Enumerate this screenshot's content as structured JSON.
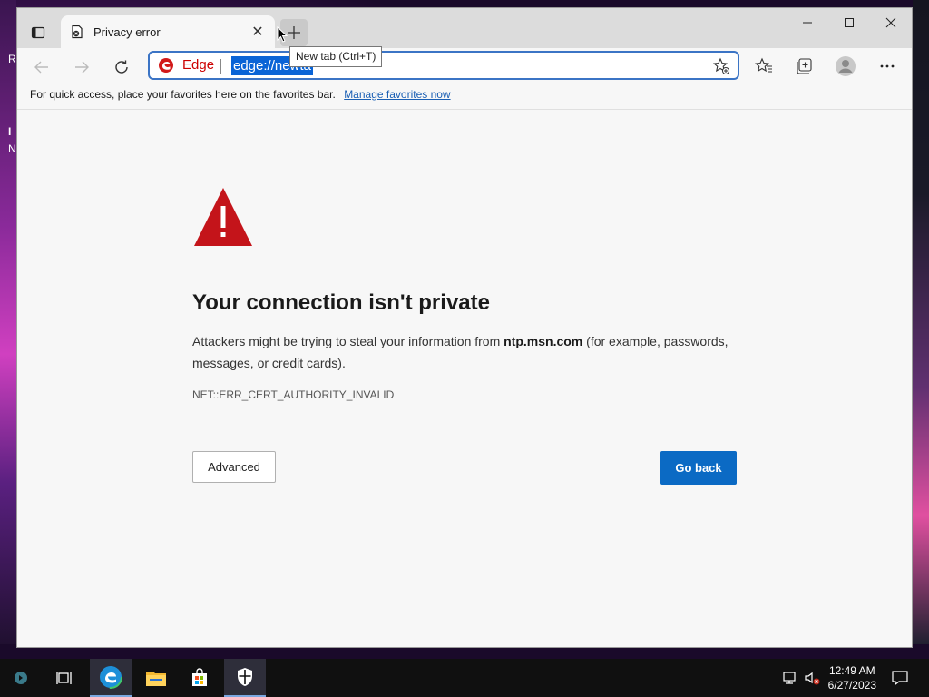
{
  "desktop": {
    "letters": [
      "R",
      "I",
      "N"
    ]
  },
  "tab": {
    "title": "Privacy error",
    "close_glyph": "✕"
  },
  "tooltip": "New tab (Ctrl+T)",
  "address": {
    "label": "Edge",
    "url": "edge://newta"
  },
  "favbar": {
    "text": "For quick access, place your favorites here on the favorites bar.",
    "link": "Manage favorites now"
  },
  "error": {
    "title": "Your connection isn't private",
    "desc_before": "Attackers might be trying to steal your information from ",
    "host": "ntp.msn.com",
    "desc_after": " (for example, passwords, messages, or credit cards).",
    "code": "NET::ERR_CERT_AUTHORITY_INVALID",
    "advanced_label": "Advanced",
    "goback_label": "Go back"
  },
  "clock": {
    "time": "12:49 AM",
    "date": "6/27/2023"
  },
  "colors": {
    "accent": "#0b6ac4",
    "warning": "#c4141a"
  }
}
